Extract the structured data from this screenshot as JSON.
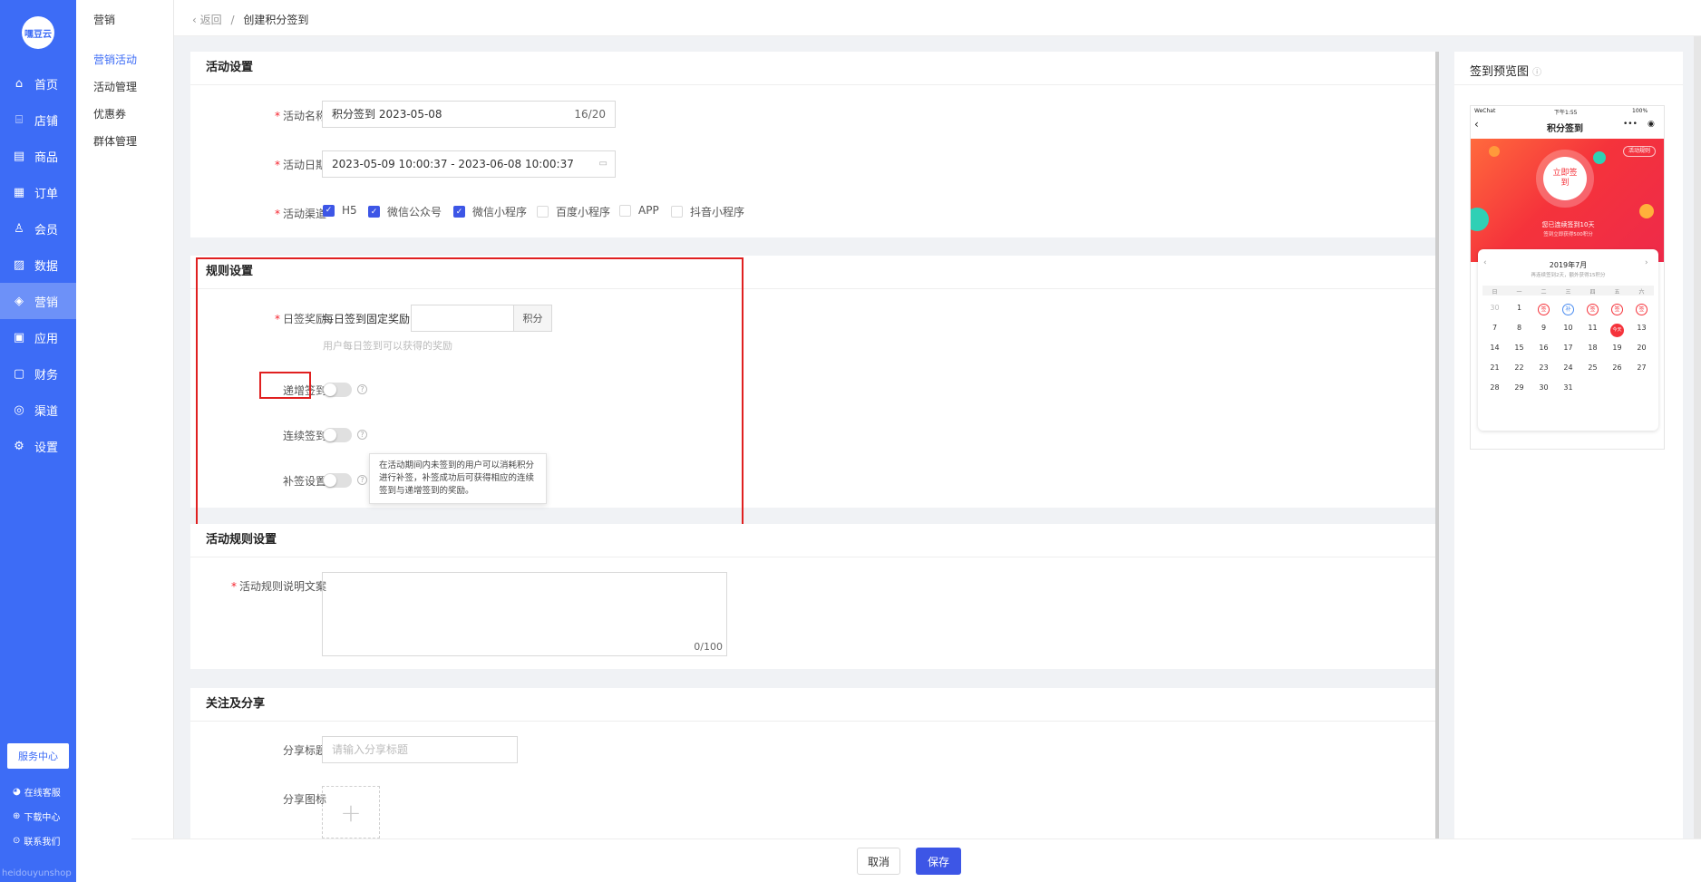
{
  "sidebar": {
    "logo": "嘿豆云",
    "items": [
      {
        "label": "首页",
        "icon": "home-icon",
        "glyph": "⌂"
      },
      {
        "label": "店铺",
        "icon": "shop-icon",
        "glyph": "⌸"
      },
      {
        "label": "商品",
        "icon": "goods-icon",
        "glyph": "▤"
      },
      {
        "label": "订单",
        "icon": "order-icon",
        "glyph": "▦"
      },
      {
        "label": "会员",
        "icon": "member-icon",
        "glyph": "♙"
      },
      {
        "label": "数据",
        "icon": "data-icon",
        "glyph": "▨"
      },
      {
        "label": "营销",
        "icon": "tag-icon",
        "glyph": "◈"
      },
      {
        "label": "应用",
        "icon": "app-icon",
        "glyph": "▣"
      },
      {
        "label": "财务",
        "icon": "finance-icon",
        "glyph": "▢"
      },
      {
        "label": "渠道",
        "icon": "channel-icon",
        "glyph": "◎"
      },
      {
        "label": "设置",
        "icon": "gear-icon",
        "glyph": "⚙"
      }
    ],
    "service": "服务中心",
    "footer": [
      {
        "label": "在线客服",
        "icon": "chat-icon",
        "glyph": "◕"
      },
      {
        "label": "下载中心",
        "icon": "download-icon",
        "glyph": "⊕"
      },
      {
        "label": "联系我们",
        "icon": "contact-icon",
        "glyph": "⊙"
      }
    ],
    "watermark": "heidouyunshop"
  },
  "submenu": {
    "head": "营销",
    "items": [
      "营销活动",
      "活动管理",
      "优惠券",
      "群体管理"
    ]
  },
  "breadcrumb": {
    "back": "返回",
    "sep": "/",
    "current": "创建积分签到"
  },
  "activity": {
    "title": "活动设置",
    "name_label": "活动名称",
    "name_value": "积分签到  2023-05-08",
    "name_count": "16/20",
    "date_label": "活动日期",
    "date_value": "2023-05-09 10:00:37 - 2023-06-08 10:00:37",
    "channel_label": "活动渠道",
    "channels": [
      {
        "label": "H5",
        "checked": true
      },
      {
        "label": "微信公众号",
        "checked": true
      },
      {
        "label": "微信小程序",
        "checked": true
      },
      {
        "label": "百度小程序",
        "checked": false
      },
      {
        "label": "APP",
        "checked": false
      },
      {
        "label": "抖音小程序",
        "checked": false
      }
    ]
  },
  "rules": {
    "title": "规则设置",
    "daily_label": "日签奖励",
    "daily_text": "每日签到固定奖励",
    "daily_unit": "积分",
    "daily_hint": "用户每日签到可以获得的奖励",
    "increase_label": "递增签到",
    "increase_on": false,
    "continuous_label": "连续签到",
    "continuous_on": false,
    "makeup_label": "补签设置",
    "makeup_on": false,
    "tooltip": "在活动期间内未签到的用户可以消耗积分进行补签，补签成功后可获得相应的连续签到与递增签到的奖励。"
  },
  "activity_rules": {
    "title": "活动规则设置",
    "desc_label": "活动规则说明文案",
    "count": "0/100"
  },
  "share": {
    "title": "关注及分享",
    "share_title_label": "分享标题",
    "share_title_placeholder": "请输入分享标题",
    "share_icon_label": "分享图标"
  },
  "footer_buttons": {
    "cancel": "取消",
    "save": "保存"
  },
  "preview": {
    "title": "签到预览图",
    "status_left": "WeChat",
    "status_time": "下午1:55",
    "status_right": "100%",
    "page_title": "积分签到",
    "rules_badge": "活动规则",
    "sign_button": "立即签到",
    "streak": "您已连续签到10天",
    "streak_sub": "签到立即获得500积分",
    "month": "2019年7月",
    "month_sub": "再连续签到2天，额外获得15积分",
    "weekdays": [
      "日",
      "一",
      "二",
      "三",
      "四",
      "五",
      "六"
    ],
    "today_label": "今天",
    "days": [
      [
        "30",
        "1",
        "签",
        "补",
        "签",
        "签",
        "签"
      ],
      [
        "7",
        "8",
        "9",
        "10",
        "11",
        "今天",
        "13"
      ],
      [
        "14",
        "15",
        "16",
        "17",
        "18",
        "19",
        "20"
      ],
      [
        "21",
        "22",
        "23",
        "24",
        "25",
        "26",
        "27"
      ],
      [
        "28",
        "29",
        "30",
        "31",
        "",
        "",
        ""
      ]
    ]
  },
  "colors": {
    "primary": "#3d6cf6",
    "save": "#3d56e6",
    "highlight": "#e02020",
    "banner": "#f5333b"
  }
}
